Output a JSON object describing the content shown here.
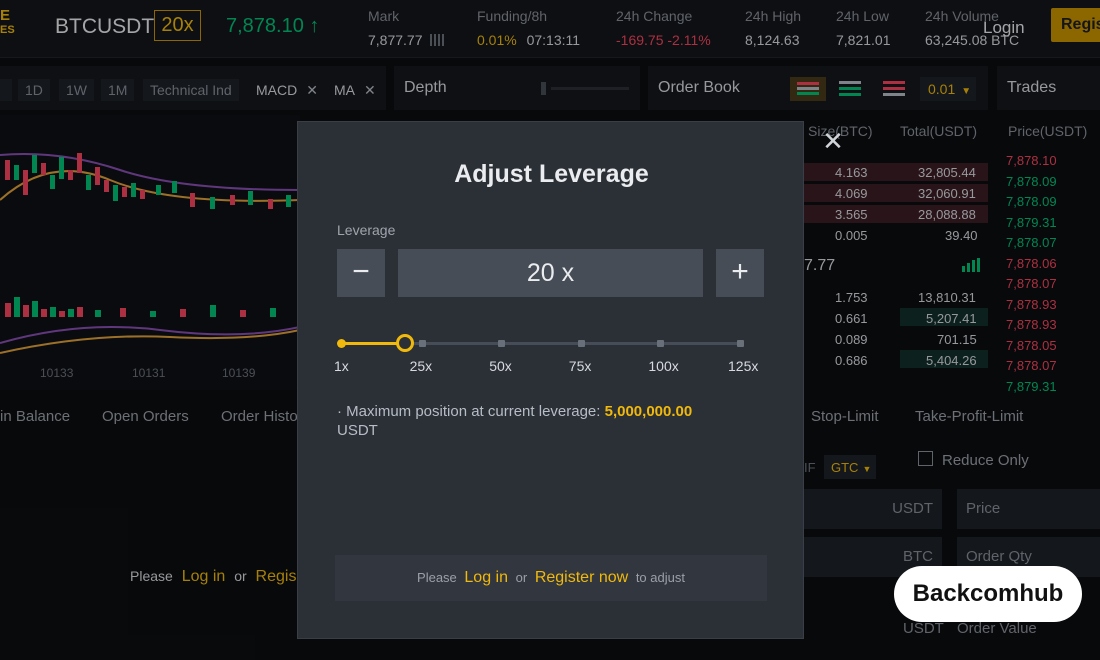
{
  "header": {
    "brand_line1": "E",
    "brand_line2": "ES",
    "symbol": "BTCUSDT",
    "leverage": "20x",
    "last_price": "7,878.10",
    "price_arrow": "↑",
    "stats": [
      {
        "label": "Mark",
        "value": "7,877.77"
      },
      {
        "label": "Funding/8h",
        "value": "0.01%",
        "extra": "07:13:11"
      },
      {
        "label": "24h Change",
        "value": "-169.75 -2.11%"
      },
      {
        "label": "24h High",
        "value": "8,124.63"
      },
      {
        "label": "24h Low",
        "value": "7,821.01"
      },
      {
        "label": "24h Volume",
        "value": "63,245.08 BTC"
      }
    ],
    "login": "Login",
    "register": "Regis"
  },
  "toolbar": {
    "items": [
      "1D",
      "1W",
      "1M",
      "Technical Ind",
      "MACD",
      "MA"
    ],
    "close_glyph": "✕"
  },
  "panels": {
    "depth": "Depth",
    "order_book": "Order Book",
    "ob_precision": "0.01",
    "trades": "Trades"
  },
  "chart": {
    "x_labels": [
      "10133",
      "10131",
      "10139"
    ]
  },
  "bottom_tabs": [
    "in Balance",
    "Open Orders",
    "Order Histo"
  ],
  "order_book": {
    "col_size": "Size(BTC)",
    "col_total": "Total(USDT)",
    "asks": [
      {
        "size": "4.163",
        "total": "32,805.44"
      },
      {
        "size": "4.069",
        "total": "32,060.91"
      },
      {
        "size": "3.565",
        "total": "28,088.88"
      },
      {
        "size": "0.005",
        "total": "39.40"
      }
    ],
    "mid": "7.77",
    "bids": [
      {
        "size": "1.753",
        "total": "13,810.31"
      },
      {
        "size": "0.661",
        "total": "5,207.41"
      },
      {
        "size": "0.089",
        "total": "701.15"
      },
      {
        "size": "0.686",
        "total": "5,404.26"
      }
    ]
  },
  "trades": {
    "col_price": "Price(USDT)",
    "prices": [
      {
        "p": "7,878.10",
        "side": "sell"
      },
      {
        "p": "7,878.09",
        "side": "buy"
      },
      {
        "p": "7,878.09",
        "side": "buy"
      },
      {
        "p": "7,879.31",
        "side": "buy"
      },
      {
        "p": "7,878.07",
        "side": "buy"
      },
      {
        "p": "7,878.06",
        "side": "sell"
      },
      {
        "p": "7,878.07",
        "side": "sell"
      },
      {
        "p": "7,878.93",
        "side": "sell"
      },
      {
        "p": "7,878.93",
        "side": "sell"
      },
      {
        "p": "7,878.05",
        "side": "sell"
      },
      {
        "p": "7,878.07",
        "side": "sell"
      },
      {
        "p": "7,879.31",
        "side": "buy"
      }
    ]
  },
  "order_form": {
    "tab_stop_limit": "Stop-Limit",
    "tab_tp_limit": "Take-Profit-Limit",
    "tif_label": "IF",
    "tif_value": "GTC",
    "reduce_only": "Reduce Only",
    "unit_usdt": "USDT",
    "price_placeholder": "Price",
    "unit_btc": "BTC",
    "qty_placeholder": "Order Qty",
    "unit_usdt2": "USDT",
    "value_placeholder": "Order Value"
  },
  "left_footer": {
    "please": "Please",
    "login": "Log in",
    "or": "or",
    "register": "Regis"
  },
  "modal": {
    "title": "Adjust Leverage",
    "leverage_label": "Leverage",
    "minus": "−",
    "plus": "+",
    "value": "20 x",
    "slider_min": 1,
    "slider_max": 125,
    "slider_value": 20,
    "ticks": [
      "1x",
      "25x",
      "50x",
      "75x",
      "100x",
      "125x"
    ],
    "max_position_text": "· Maximum position at current leverage:",
    "max_position_value": "5,000,000.00",
    "max_position_unit": "USDT",
    "footer_please": "Please",
    "footer_login": "Log in",
    "footer_or": "or",
    "footer_register": "Register now",
    "footer_suffix": "to adjust",
    "close_glyph": "✕"
  },
  "watermark": "Backcomhub",
  "colors": {
    "accent": "#f0b90b",
    "buy": "#02c076",
    "sell": "#f6465d",
    "modal_bg": "#2b2f36"
  }
}
